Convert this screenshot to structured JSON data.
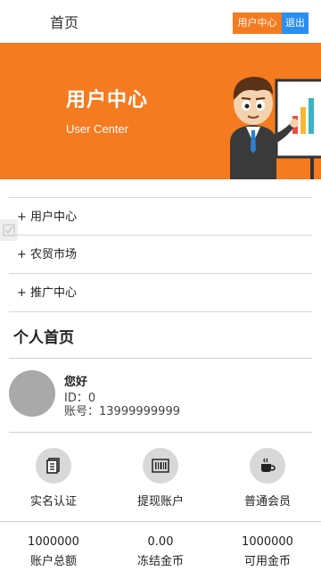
{
  "header": {
    "home_label": "首页",
    "user_center_label": "用户中心",
    "logout_label": "退出",
    "accent_color": "#f47b20",
    "logout_color": "#2a8ff0"
  },
  "banner": {
    "title": "用户中心",
    "subtitle": "User Center",
    "illustration_icon": "businessman-presentation-illustration"
  },
  "menu": {
    "items": [
      {
        "label": "+ 用户中心"
      },
      {
        "label": "+ 农贸市场"
      },
      {
        "label": "+ 推广中心"
      }
    ]
  },
  "profile": {
    "section_title": "个人首页",
    "greeting": "您好",
    "id_text": "ID：0",
    "account_text": "账号：13999999999"
  },
  "features": [
    {
      "label": "实名认证",
      "icon": "document-icon"
    },
    {
      "label": "提现账户",
      "icon": "barcode-icon"
    },
    {
      "label": "普通会员",
      "icon": "coffee-cup-icon"
    }
  ],
  "stats": [
    {
      "value": "1000000",
      "label": "账户总额"
    },
    {
      "value": "0.00",
      "label": "冻结金币"
    },
    {
      "value": "1000000",
      "label": "可用金币"
    }
  ]
}
